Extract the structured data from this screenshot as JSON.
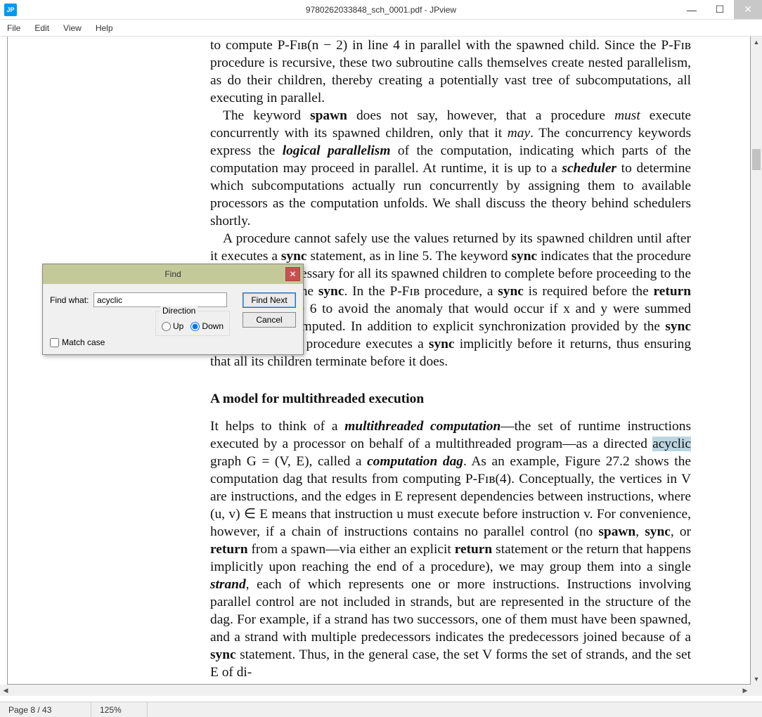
{
  "window": {
    "app_icon": "JP",
    "title": "9780262033848_sch_0001.pdf - JPview",
    "controls": {
      "min": "—",
      "max": "☐",
      "close": "✕"
    }
  },
  "menu": {
    "items": [
      "File",
      "Edit",
      "View",
      "Help"
    ]
  },
  "status": {
    "page": "Page 8 / 43",
    "zoom": "125%"
  },
  "find": {
    "title": "Find",
    "label": "Find what:",
    "value": "acyclic",
    "direction_label": "Direction",
    "up": "Up",
    "down": "Down",
    "match_case": "Match case",
    "find_next": "Find Next",
    "cancel": "Cancel",
    "close": "✕",
    "direction_selected": "down",
    "match_case_checked": false
  },
  "doc": {
    "p1": "to compute P-Fɪʙ(n − 2) in line 4 in parallel with the spawned child. Since the P-Fɪʙ procedure is recursive, these two subroutine calls themselves create nested parallelism, as do their children, thereby creating a potentially vast tree of subcomputations, all executing in parallel.",
    "p2a": "The keyword ",
    "p2b": " does not say, however, that a procedure ",
    "p2c": " execute concurrently with its spawned children, only that it ",
    "p2d": ". The concurrency keywords express the ",
    "p2e": " of the computation, indicating which parts of the computation may proceed in parallel. At runtime, it is up to a ",
    "p2f": " to determine which subcomputations actually run concurrently by assigning them to available processors as the computation unfolds. We shall discuss the theory behind schedulers shortly.",
    "kw_spawn": "spawn",
    "kw_must": "must",
    "kw_may": "may",
    "kw_logpar": "logical parallelism",
    "kw_scheduler": "scheduler",
    "p3a": "A procedure cannot safely use the values returned by its spawned children until after it executes a ",
    "p3b": " statement, as in line 5. The keyword ",
    "p3c": " indicates that the procedure must wait as necessary for all its spawned children to complete before proceeding to the statement after the ",
    "p3d": ". In the P-Fɪʙ procedure, a ",
    "p3e": " is required before the ",
    "p3f": " statement in line 6 to avoid the anomaly that would occur if x and y were summed before x was computed. In addition to explicit synchronization provided by the ",
    "p3g": " statement, every procedure executes a ",
    "p3h": " implicitly before it returns, thus ensuring that all its children terminate before it does.",
    "kw_sync": "sync",
    "kw_return": "return",
    "heading": "A model for multithreaded execution",
    "p4a": "It helps to think of a ",
    "p4b": "—the set of runtime instructions executed by a processor on behalf of a multithreaded program—as a directed ",
    "p4c": " graph G = (V, E), called a ",
    "p4d": ". As an example, Figure 27.2 shows the computation dag that results from computing P-Fɪʙ(4). Conceptually, the vertices in V are instructions, and the edges in E represent dependencies between instructions, where (u, v) ∈ E means that instruction u must execute before instruction v. For convenience, however, if a chain of instructions contains no parallel control (no ",
    "p4e": ", ",
    "p4f": ", or ",
    "p4g": " from a spawn—via either an explicit ",
    "p4h": " statement or the return that happens implicitly upon reaching the end of a procedure), we may group them into a single ",
    "p4i": ", each of which represents one or more instructions. Instructions involving parallel control are not included in strands, but are represented in the structure of the dag. For example, if a strand has two successors, one of them must have been spawned, and a strand with multiple predecessors indicates the predecessors joined because of a ",
    "p4j": " statement. Thus, in the general case, the set V forms the set of strands, and the set E of di-",
    "kw_multicomp": "multithreaded computation",
    "kw_acyclic": "acyclic",
    "kw_compdag": "computation dag",
    "kw_strand": "strand"
  }
}
